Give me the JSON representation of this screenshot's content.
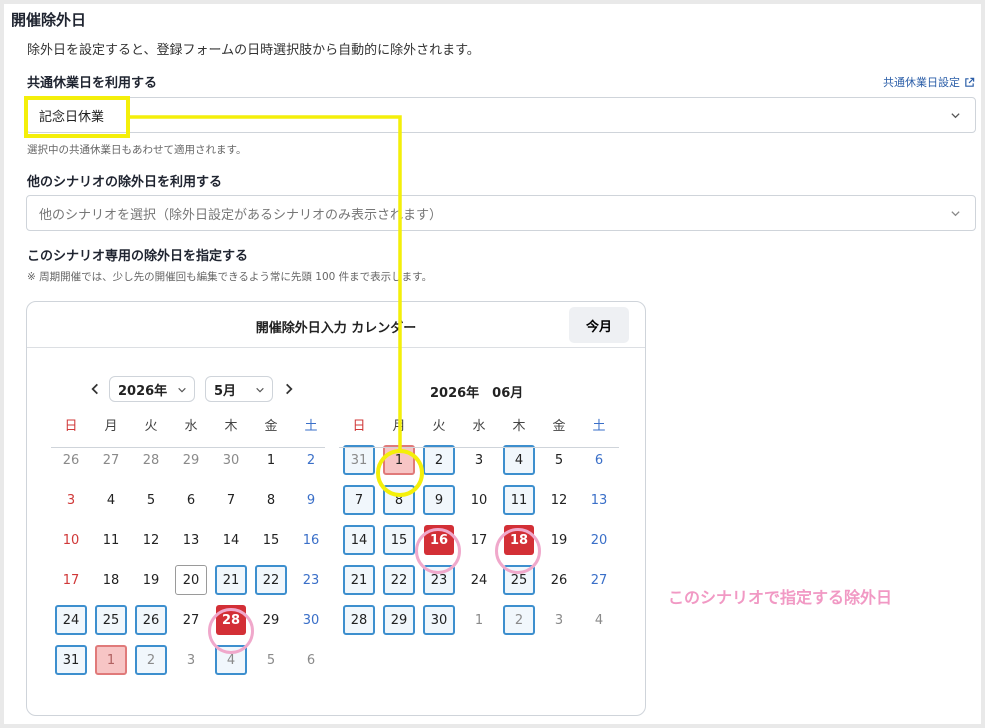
{
  "page": {
    "title": "開催除外日",
    "description": "除外日を設定すると、登録フォームの日時選択肢から自動的に除外されます。"
  },
  "shared": {
    "label": "共通休業日を利用する",
    "link": "共通休業日設定",
    "value": "記念日休業",
    "hint": "選択中の共通休業日もあわせて適用されます。"
  },
  "other": {
    "label": "他のシナリオの除外日を利用する",
    "placeholder": "他のシナリオを選択（除外日設定があるシナリオのみ表示されます）"
  },
  "own": {
    "label": "このシナリオ専用の除外日を指定する",
    "note": "※ 周期開催では、少し先の開催回も編集できるよう常に先頭 100 件まで表示します。"
  },
  "calendar": {
    "title": "開催除外日入力 カレンダー",
    "today_button": "今月",
    "weekdays": [
      "日",
      "月",
      "火",
      "水",
      "木",
      "金",
      "土"
    ],
    "left": {
      "year_select": "2026年",
      "month_select": "5月",
      "weeks": [
        [
          {
            "d": "26",
            "s": "muted"
          },
          {
            "d": "27",
            "s": "muted"
          },
          {
            "d": "28",
            "s": "muted"
          },
          {
            "d": "29",
            "s": "muted"
          },
          {
            "d": "30",
            "s": "muted"
          },
          {
            "d": "1",
            "s": ""
          },
          {
            "d": "2",
            "s": ""
          }
        ],
        [
          {
            "d": "3",
            "s": ""
          },
          {
            "d": "4",
            "s": ""
          },
          {
            "d": "5",
            "s": ""
          },
          {
            "d": "6",
            "s": ""
          },
          {
            "d": "7",
            "s": ""
          },
          {
            "d": "8",
            "s": ""
          },
          {
            "d": "9",
            "s": ""
          }
        ],
        [
          {
            "d": "10",
            "s": ""
          },
          {
            "d": "11",
            "s": ""
          },
          {
            "d": "12",
            "s": ""
          },
          {
            "d": "13",
            "s": ""
          },
          {
            "d": "14",
            "s": ""
          },
          {
            "d": "15",
            "s": ""
          },
          {
            "d": "16",
            "s": ""
          }
        ],
        [
          {
            "d": "17",
            "s": ""
          },
          {
            "d": "18",
            "s": ""
          },
          {
            "d": "19",
            "s": ""
          },
          {
            "d": "20",
            "s": "outline"
          },
          {
            "d": "21",
            "s": "box"
          },
          {
            "d": "22",
            "s": "box"
          },
          {
            "d": "23",
            "s": ""
          }
        ],
        [
          {
            "d": "24",
            "s": "box"
          },
          {
            "d": "25",
            "s": "box"
          },
          {
            "d": "26",
            "s": "box"
          },
          {
            "d": "27",
            "s": ""
          },
          {
            "d": "28",
            "s": "sel"
          },
          {
            "d": "29",
            "s": ""
          },
          {
            "d": "30",
            "s": ""
          }
        ],
        [
          {
            "d": "31",
            "s": "box"
          },
          {
            "d": "1",
            "s": "hol muted"
          },
          {
            "d": "2",
            "s": "box muted"
          },
          {
            "d": "3",
            "s": "muted"
          },
          {
            "d": "4",
            "s": "box muted"
          },
          {
            "d": "5",
            "s": "muted"
          },
          {
            "d": "6",
            "s": "muted"
          }
        ]
      ]
    },
    "right": {
      "title": "2026年　06月",
      "weeks": [
        [
          {
            "d": "31",
            "s": "box muted"
          },
          {
            "d": "1",
            "s": "hol"
          },
          {
            "d": "2",
            "s": "box"
          },
          {
            "d": "3",
            "s": ""
          },
          {
            "d": "4",
            "s": "box"
          },
          {
            "d": "5",
            "s": ""
          },
          {
            "d": "6",
            "s": ""
          }
        ],
        [
          {
            "d": "7",
            "s": "box"
          },
          {
            "d": "8",
            "s": "box"
          },
          {
            "d": "9",
            "s": "box"
          },
          {
            "d": "10",
            "s": ""
          },
          {
            "d": "11",
            "s": "box"
          },
          {
            "d": "12",
            "s": ""
          },
          {
            "d": "13",
            "s": ""
          }
        ],
        [
          {
            "d": "14",
            "s": "box"
          },
          {
            "d": "15",
            "s": "box"
          },
          {
            "d": "16",
            "s": "sel"
          },
          {
            "d": "17",
            "s": ""
          },
          {
            "d": "18",
            "s": "sel"
          },
          {
            "d": "19",
            "s": ""
          },
          {
            "d": "20",
            "s": ""
          }
        ],
        [
          {
            "d": "21",
            "s": "box"
          },
          {
            "d": "22",
            "s": "box"
          },
          {
            "d": "23",
            "s": "box"
          },
          {
            "d": "24",
            "s": ""
          },
          {
            "d": "25",
            "s": "box"
          },
          {
            "d": "26",
            "s": ""
          },
          {
            "d": "27",
            "s": ""
          }
        ],
        [
          {
            "d": "28",
            "s": "box"
          },
          {
            "d": "29",
            "s": "box"
          },
          {
            "d": "30",
            "s": "box"
          },
          {
            "d": "1",
            "s": "muted"
          },
          {
            "d": "2",
            "s": "box muted"
          },
          {
            "d": "3",
            "s": "muted"
          },
          {
            "d": "4",
            "s": "muted"
          }
        ]
      ]
    }
  },
  "annotation": "このシナリオで指定する除外日",
  "colors": {
    "selected": "#d32f36",
    "holiday": "#f7c5c5",
    "box_border": "#3d8fce",
    "highlight_yellow": "#f4ef0a",
    "highlight_pink": "#f0a8cb",
    "link": "#2b5ea8"
  },
  "icons": {
    "external_link": "external-link-icon",
    "chevron": "chevron-down-icon",
    "prev": "chevron-left-icon",
    "next": "chevron-right-icon"
  }
}
